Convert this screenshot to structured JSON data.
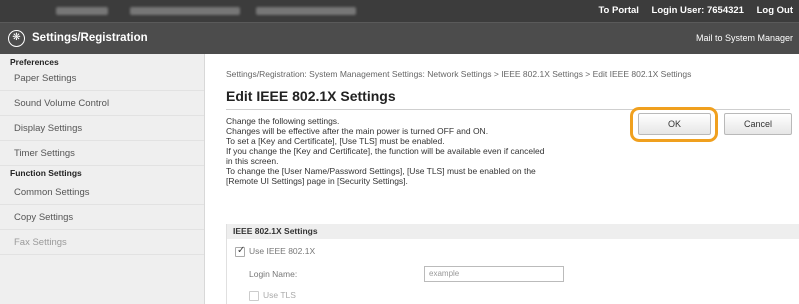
{
  "topbar": {
    "portal_link": "To Portal",
    "login_user": "Login User: 7654321",
    "logout": "Log Out"
  },
  "header": {
    "title": "Settings/Registration",
    "mail_link": "Mail to System Manager"
  },
  "sidebar": {
    "preferences_label": "Preferences",
    "preferences_items": [
      "Paper Settings",
      "Sound Volume Control",
      "Display Settings",
      "Timer Settings"
    ],
    "function_label": "Function Settings",
    "function_items": [
      "Common Settings",
      "Copy Settings",
      "Fax Settings"
    ]
  },
  "main": {
    "breadcrumb": "Settings/Registration: System Management Settings: Network Settings > IEEE 802.1X Settings > Edit IEEE 802.1X Settings",
    "title": "Edit IEEE 802.1X Settings",
    "description": [
      "Change the following settings.",
      "Changes will be effective after the main power is turned OFF and ON.",
      "To set a [Key and Certificate], [Use TLS] must be enabled.",
      "If you change the [Key and Certificate], the function will be available even if canceled",
      "in this screen.",
      "To change the [User Name/Password Settings], [Use TLS] must be enabled on the",
      "[Remote UI Settings] page in [Security Settings]."
    ],
    "ok_label": "OK",
    "cancel_label": "Cancel",
    "section": {
      "title": "IEEE 802.1X Settings",
      "use_ieee_label": "Use IEEE 802.1X",
      "use_ieee_checked": true,
      "login_name_label": "Login Name:",
      "login_name_value": "example",
      "use_tls_label": "Use TLS",
      "use_tls_checked": false
    }
  }
}
